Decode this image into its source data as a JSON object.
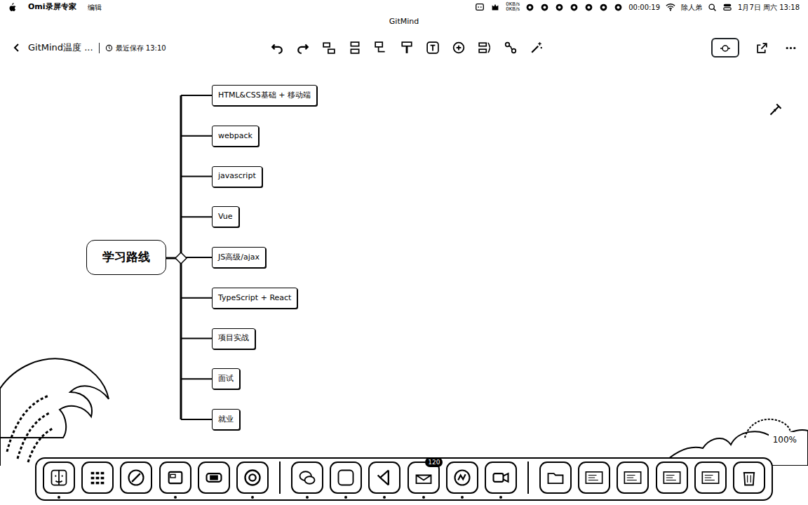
{
  "menu_bar": {
    "app": "Omi录屏专家",
    "menus": [
      "编辑"
    ],
    "net_up": "0KB/s",
    "net_down": "0KB/s",
    "timer": "00:00:19",
    "user": "除人弟",
    "datetime": "1月7日 周六 13:18"
  },
  "window": {
    "title": "GitMind"
  },
  "toolbar": {
    "doc_title": "GitMind温度 ...",
    "saved": "最近保存 13:10"
  },
  "mindmap": {
    "root": "学习路线",
    "children": [
      "HTML&CSS基础 + 移动端",
      "webpack",
      "javascript",
      "Vue",
      "JS高级/ajax",
      "TypeScript + React",
      "项目实战",
      "面试",
      "就业"
    ]
  },
  "zoom": "100%",
  "dock": {
    "items": [
      {
        "kind": "finder",
        "running": true,
        "badge": ""
      },
      {
        "kind": "grid",
        "running": false,
        "badge": ""
      },
      {
        "kind": "compass",
        "running": false,
        "badge": ""
      },
      {
        "kind": "window",
        "running": true,
        "badge": ""
      },
      {
        "kind": "box",
        "running": false,
        "badge": ""
      },
      {
        "kind": "chrome",
        "running": true,
        "badge": ""
      },
      {
        "kind": "sep",
        "running": false,
        "badge": ""
      },
      {
        "kind": "chat",
        "running": true,
        "badge": ""
      },
      {
        "kind": "blank",
        "running": true,
        "badge": ""
      },
      {
        "kind": "code",
        "running": true,
        "badge": ""
      },
      {
        "kind": "mail",
        "running": true,
        "badge": "120"
      },
      {
        "kind": "mind",
        "running": true,
        "badge": ""
      },
      {
        "kind": "video",
        "running": true,
        "badge": ""
      },
      {
        "kind": "sep",
        "running": false,
        "badge": ""
      },
      {
        "kind": "folder",
        "running": false,
        "badge": ""
      },
      {
        "kind": "thumb",
        "running": false,
        "badge": ""
      },
      {
        "kind": "thumb",
        "running": false,
        "badge": ""
      },
      {
        "kind": "thumb",
        "running": false,
        "badge": ""
      },
      {
        "kind": "thumb",
        "running": false,
        "badge": ""
      },
      {
        "kind": "trash",
        "running": false,
        "badge": ""
      }
    ]
  }
}
